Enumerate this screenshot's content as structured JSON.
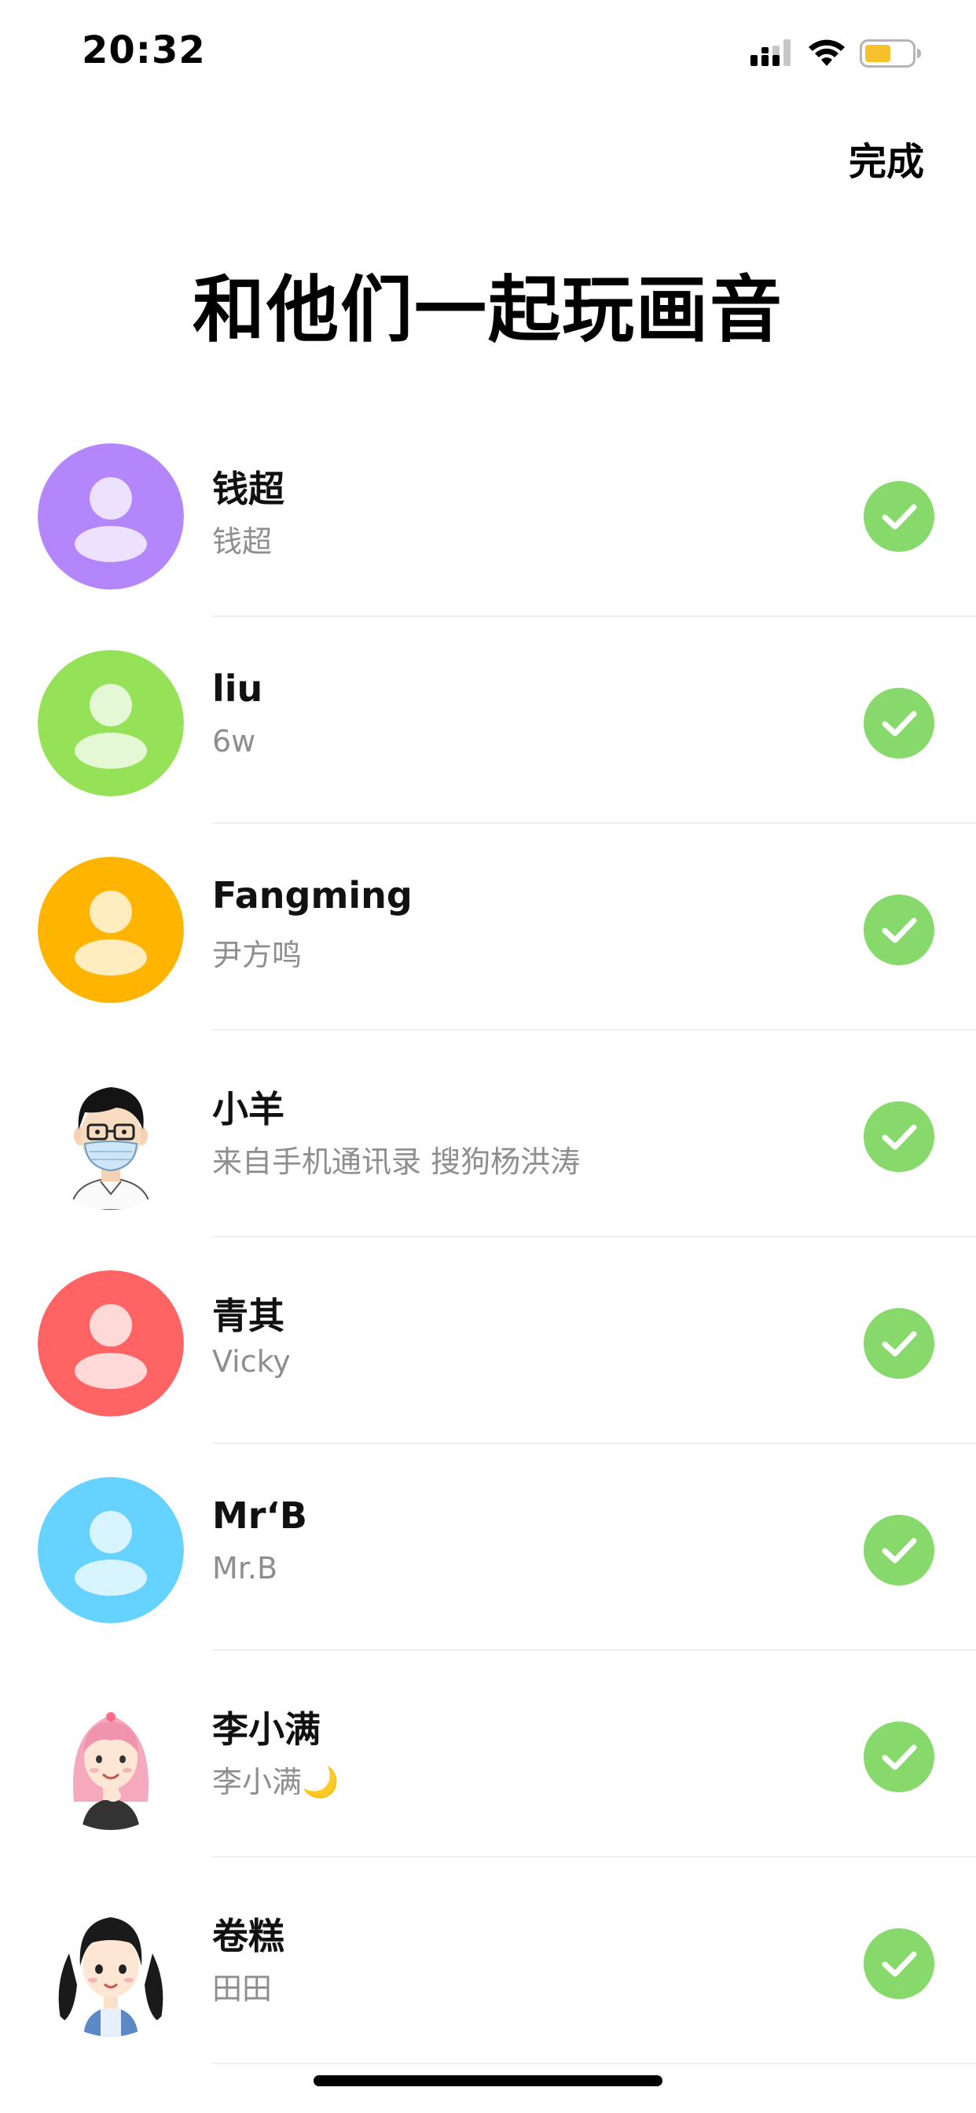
{
  "status_bar": {
    "time": "20:32"
  },
  "header": {
    "done_label": "完成",
    "title": "和他们一起玩画音"
  },
  "colors": {
    "check": "#86d96a",
    "subtitle": "#8e8e8e"
  },
  "contacts": [
    {
      "name": "钱超",
      "subtitle": "钱超",
      "avatar": "default-avatar",
      "color": "#b486fb",
      "selected": true
    },
    {
      "name": "liu",
      "subtitle": "6w",
      "avatar": "default-avatar",
      "color": "#95e157",
      "selected": true
    },
    {
      "name": "Fangming",
      "subtitle": "尹方鸣",
      "avatar": "default-avatar",
      "color": "#ffb400",
      "selected": true
    },
    {
      "name": "小羊",
      "subtitle": "来自手机通讯录 搜狗杨洪涛",
      "avatar": "cartoon-boy-mask",
      "color": "#ffffff",
      "selected": true
    },
    {
      "name": "青其",
      "subtitle": "Vicky",
      "avatar": "default-avatar",
      "color": "#ff6464",
      "selected": true
    },
    {
      "name": "Mr‘B",
      "subtitle": "Mr.B",
      "avatar": "default-avatar",
      "color": "#66d2ff",
      "selected": true
    },
    {
      "name": "李小满",
      "subtitle": "李小满🌙",
      "avatar": "cartoon-girl-pink-hair",
      "color": "#ffffff",
      "selected": true
    },
    {
      "name": "卷糕",
      "subtitle": "田田",
      "avatar": "cartoon-girl-pigtails",
      "color": "#ffffff",
      "selected": true
    }
  ]
}
